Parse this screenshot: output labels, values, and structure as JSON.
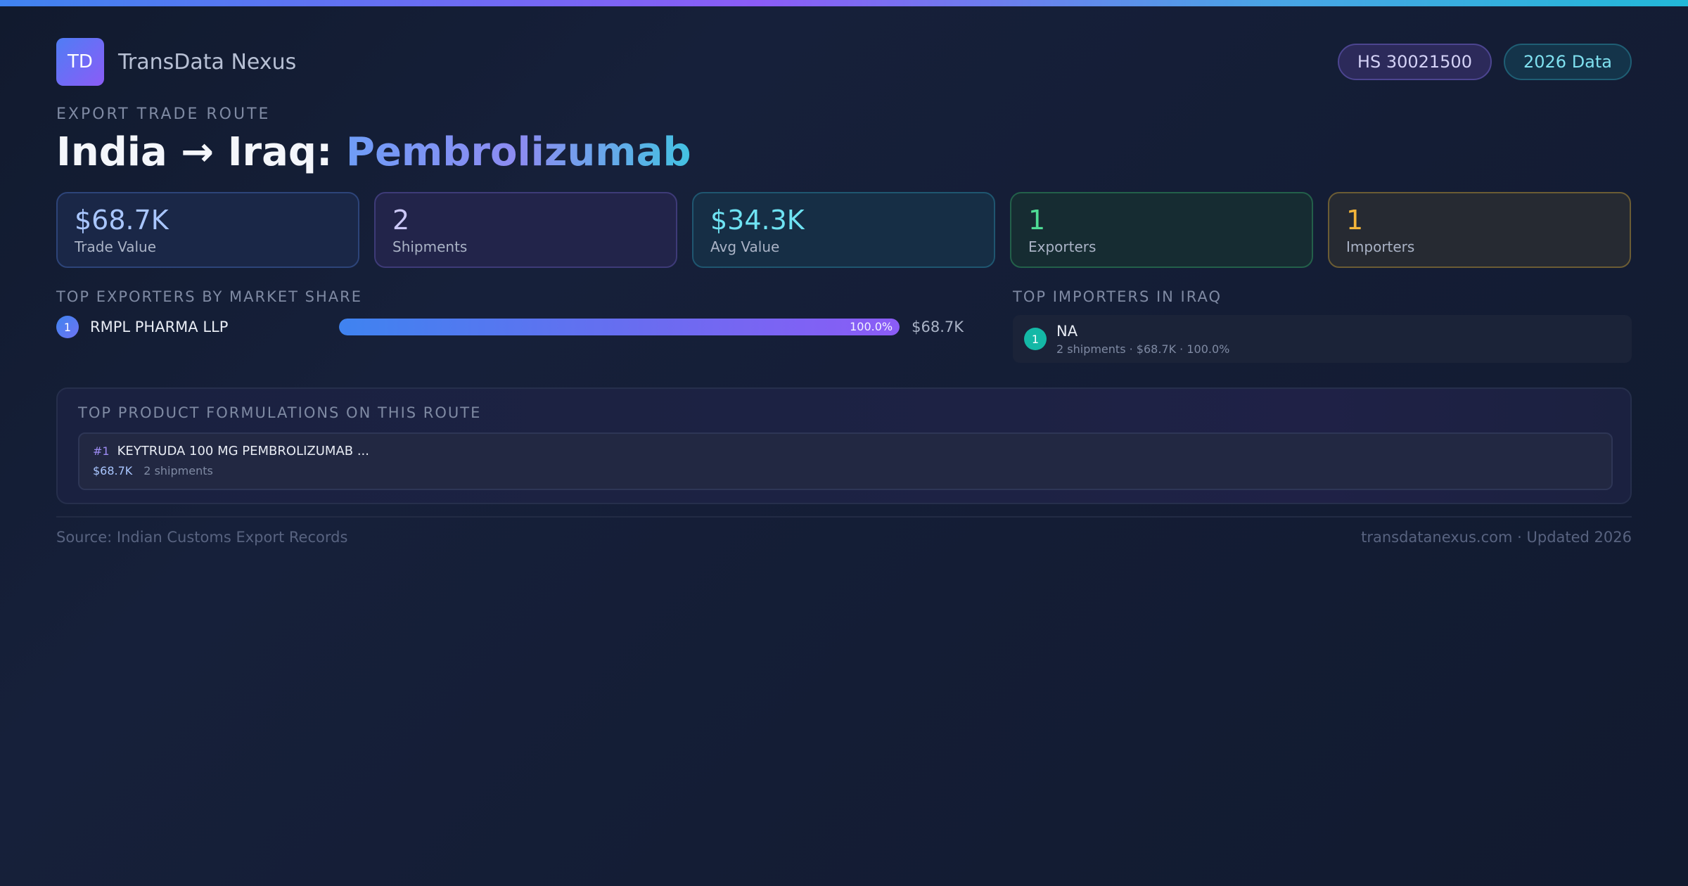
{
  "brand": {
    "logo_text": "TD",
    "name": "TransData Nexus"
  },
  "badges": {
    "hs_code": "HS 30021500",
    "data_year": "2026 Data"
  },
  "route": {
    "eyebrow": "EXPORT TRADE ROUTE",
    "title_prefix": "India → Iraq: ",
    "title_product": "Pembrolizumab"
  },
  "stats": [
    {
      "value": "$68.7K",
      "label": "Trade Value",
      "accent": "#a9c6ff"
    },
    {
      "value": "2",
      "label": "Shipments",
      "accent": "#cbc8f7"
    },
    {
      "value": "$34.3K",
      "label": "Avg Value",
      "accent": "#6fe3f3"
    },
    {
      "value": "1",
      "label": "Exporters",
      "accent": "#4fdc95"
    },
    {
      "value": "1",
      "label": "Importers",
      "accent": "#f3b53a"
    }
  ],
  "exporters": {
    "heading": "TOP EXPORTERS BY MARKET SHARE",
    "items": [
      {
        "rank": "1",
        "name": "RMPL PHARMA LLP",
        "share": 100.0,
        "share_label": "100.0%",
        "value": "$68.7K"
      }
    ]
  },
  "importers": {
    "heading": "TOP IMPORTERS IN IRAQ",
    "items": [
      {
        "rank": "1",
        "name": "NA",
        "meta": "2 shipments · $68.7K · 100.0%"
      }
    ]
  },
  "formulations": {
    "heading": "TOP PRODUCT FORMULATIONS ON THIS ROUTE",
    "items": [
      {
        "rank": "#1",
        "name": "KEYTRUDA 100 MG PEMBROLIZUMAB ...",
        "value": "$68.7K",
        "shipments": "2 shipments"
      }
    ]
  },
  "footer": {
    "source": "Source: Indian Customs Export Records",
    "site": "transdatanexus.com · Updated 2026"
  }
}
